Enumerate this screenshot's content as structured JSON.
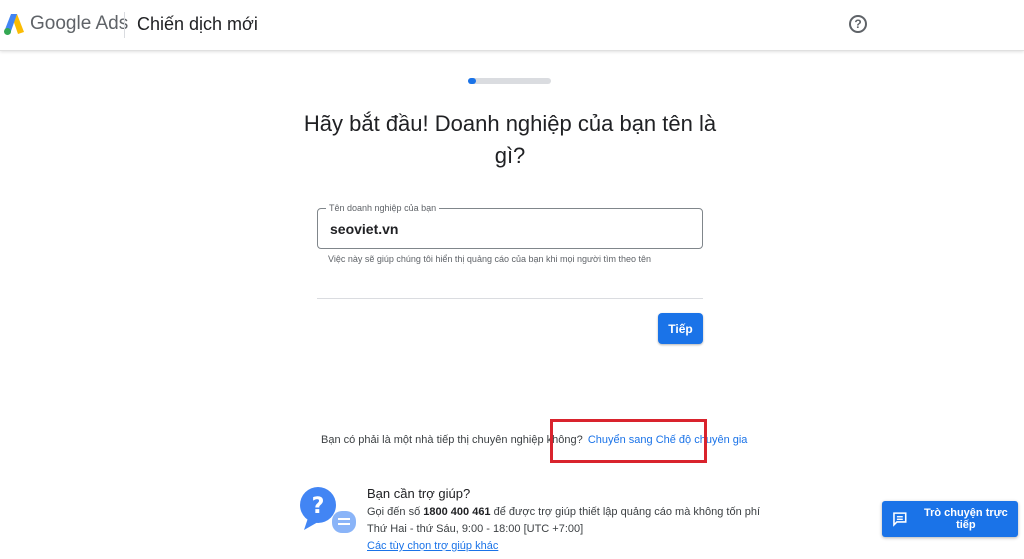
{
  "header": {
    "brand": "Google Ads",
    "title": "Chiến dịch mới",
    "help_icon_glyph": "?"
  },
  "progress": {
    "fraction": 0.1
  },
  "main": {
    "heading": "Hãy bắt đầu! Doanh nghiệp của bạn tên là gì?",
    "field": {
      "label": "Tên doanh nghiệp của bạn",
      "value": "seoviet.vn",
      "hint": "Việc này sẽ giúp chúng tôi hiển thị quảng cáo của bạn khi mọi người tìm theo tên"
    },
    "next_label": "Tiếp",
    "expert_prompt": "Bạn có phải là một nhà tiếp thị chuyên nghiệp không?",
    "expert_link": "Chuyển sang Chế độ chuyên gia"
  },
  "support": {
    "title": "Bạn cần trợ giúp?",
    "phone_prefix": "Gọi đến số",
    "phone": "1800 400 461",
    "phone_suffix": "để được trợ giúp thiết lập quảng cáo mà không tốn phí",
    "hours": "Thứ Hai - thứ Sáu, 9:00 - 18:00 [UTC +7:00]",
    "link": "Các tùy chọn trợ giúp khác"
  },
  "chat": {
    "label": "Trò chuyện trực tiếp"
  },
  "colors": {
    "accent": "#1a73e8",
    "highlight": "#d9232d"
  }
}
